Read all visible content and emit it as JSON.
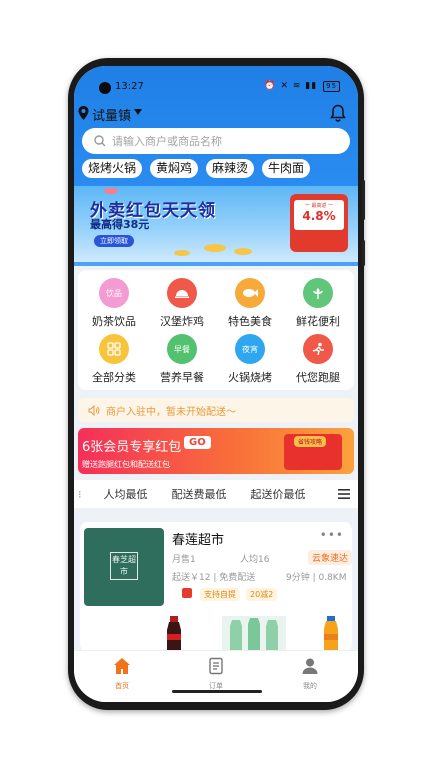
{
  "status": {
    "time": "13:27",
    "battery": "95"
  },
  "location": {
    "label": "试量镇"
  },
  "search": {
    "placeholder": "请输入商户或商品名称"
  },
  "chips": [
    "烧烤火锅",
    "黄焖鸡",
    "麻辣烫",
    "牛肉面"
  ],
  "banner": {
    "title": "外卖红包天天领",
    "subtitle": "最高得38元",
    "button": "立即领取",
    "card_head": "一 最高返 一",
    "card_rate": "4.8%"
  },
  "categories": [
    {
      "label": "奶茶饮品",
      "icon": "drink-icon",
      "icon_text": "饮品",
      "color": "#f49bd3"
    },
    {
      "label": "汉堡炸鸡",
      "icon": "cloche-icon",
      "icon_text": "",
      "color": "#f0584a"
    },
    {
      "label": "特色美食",
      "icon": "fish-icon",
      "icon_text": "",
      "color": "#f7a93a"
    },
    {
      "label": "鲜花便利",
      "icon": "flower-icon",
      "icon_text": "",
      "color": "#5fc67a"
    },
    {
      "label": "全部分类",
      "icon": "grid-icon",
      "icon_text": "",
      "color": "#f8c43b"
    },
    {
      "label": "营养早餐",
      "icon": "breakfast-icon",
      "icon_text": "早餐",
      "color": "#52c26e"
    },
    {
      "label": "火锅烧烤",
      "icon": "night-snack-icon",
      "icon_text": "夜宵",
      "color": "#2ea6f0"
    },
    {
      "label": "代您跑腿",
      "icon": "runner-icon",
      "icon_text": "",
      "color": "#f0584a"
    }
  ],
  "notice": {
    "text": "商户入驻中，暂未开始配送～"
  },
  "promo": {
    "title": "6张会员专享红包",
    "go": "GO",
    "subtitle": "赠送跑腿红包和配送红包",
    "tag": "省钱攻略"
  },
  "sort_options": [
    "人均最低",
    "配送费最低",
    "起送价最低"
  ],
  "store": {
    "name": "春莲超市",
    "logo_text": "春芝超市",
    "monthly_sales": "月售1",
    "per_capita": "人均16",
    "badge": "云象速达",
    "delivery_info": "起送￥12 | 免费配送",
    "time_distance": "9分钟 | 0.8KM",
    "tags": [
      "支持自提",
      "20减2"
    ],
    "more": "•••"
  },
  "tabbar": [
    {
      "label": "首页",
      "icon": "home-icon",
      "active": true
    },
    {
      "label": "订单",
      "icon": "order-icon",
      "active": false
    },
    {
      "label": "我的",
      "icon": "profile-icon",
      "active": false
    }
  ],
  "colors": {
    "accent": "#f0731a",
    "header_blue": "#2a8cf0",
    "promo_start": "#f52f5b",
    "promo_end": "#fba23b"
  }
}
